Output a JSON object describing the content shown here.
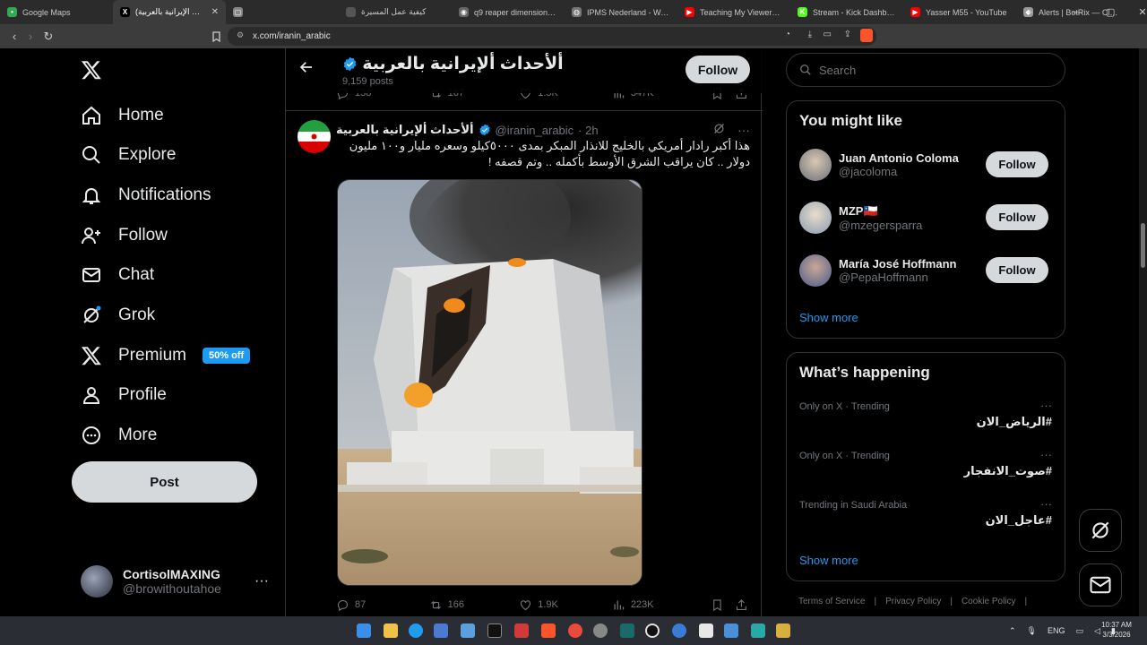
{
  "browser": {
    "tabs": [
      {
        "label": "Google Maps",
        "color": "#34a853",
        "glyph": "•"
      },
      {
        "label": "(الأحداث الإيرانية بالعربية) ... / X",
        "color": "#000000",
        "glyph": "X",
        "active": true
      },
      {
        "label": "",
        "color": "#888888",
        "glyph": "▢"
      },
      {
        "label": "كيفية عمل المسيرة",
        "color": "#555555",
        "glyph": ""
      },
      {
        "label": "q9 reaper dimensions - ...",
        "color": "#666666",
        "glyph": "◉"
      },
      {
        "label": "IPMS Nederland - Walk ar...",
        "color": "#777777",
        "glyph": "◍"
      },
      {
        "label": "Teaching My Viewers How...",
        "color": "#ff0000",
        "glyph": "▶"
      },
      {
        "label": "Stream - Kick Dashboard",
        "color": "#53fc18",
        "glyph": "K"
      },
      {
        "label": "Yasser M55 - YouTube",
        "color": "#ff0000",
        "glyph": "▶"
      },
      {
        "label": "Alerts | BotRix — Cloud St...",
        "color": "#999999",
        "glyph": "◆"
      }
    ],
    "new_tab": "+",
    "url": "x.com/iranin_arabic"
  },
  "sidebar": {
    "logo": "X",
    "items": [
      {
        "label": "Home",
        "icon": "home-icon"
      },
      {
        "label": "Explore",
        "icon": "search-icon"
      },
      {
        "label": "Notifications",
        "icon": "bell-icon"
      },
      {
        "label": "Follow",
        "icon": "follow-icon"
      },
      {
        "label": "Chat",
        "icon": "mail-icon"
      },
      {
        "label": "Grok",
        "icon": "grok-icon"
      },
      {
        "label": "Premium",
        "icon": "x-icon",
        "badge": "50% off"
      },
      {
        "label": "Profile",
        "icon": "person-icon"
      },
      {
        "label": "More",
        "icon": "more-circle-icon"
      }
    ],
    "post_button": "Post",
    "account": {
      "name": "CortisolMAXING",
      "handle": "@browithoutahoe"
    }
  },
  "profile_header": {
    "title": "ألأحداث ألإيرانية بالعربية",
    "posts": "9,159 posts",
    "follow": "Follow"
  },
  "prev_tweet_actions": {
    "replies": "138",
    "reposts": "167",
    "likes": "1.5K",
    "views": "347K"
  },
  "tweet": {
    "name": "ألأحداث ألإيرانية بالعربية",
    "handle": "@iranin_arabic",
    "time": "· 2h",
    "text_line1": "هذا أكبر رادار أمريكي بالخليج للانذار المبكر بمدى ٥٠٠٠كيلو وسعره مليار و١٠٠ مليون",
    "text_line2": "دولار .. كان يراقب الشرق الأوسط بأكمله .. وتم قصفه !",
    "actions": {
      "replies": "87",
      "reposts": "166",
      "likes": "1.9K",
      "views": "223K"
    }
  },
  "right": {
    "search_placeholder": "Search",
    "you_might_like": {
      "title": "You might like",
      "users": [
        {
          "name": "Juan Antonio Coloma",
          "handle": "@jacoloma",
          "button": "Follow"
        },
        {
          "name": "MZP🇨🇱",
          "handle": "@mzegersparra",
          "button": "Follow"
        },
        {
          "name": "María José Hoffmann",
          "handle": "@PepaHoffmann",
          "button": "Follow"
        }
      ],
      "show_more": "Show more"
    },
    "whats_happening": {
      "title": "What’s happening",
      "trends": [
        {
          "context": "Only on X · Trending",
          "tag": "#الرياض_الان"
        },
        {
          "context": "Only on X · Trending",
          "tag": "#صوت_الانفجار"
        },
        {
          "context": "Trending in Saudi Arabia",
          "tag": "#عاجل_الان"
        }
      ],
      "show_more": "Show more"
    },
    "footer": [
      "Terms of Service",
      "Privacy Policy",
      "Cookie Policy"
    ]
  },
  "taskbar": {
    "lang": "ENG",
    "time": "10:37 AM",
    "date": "3/3/2026"
  }
}
